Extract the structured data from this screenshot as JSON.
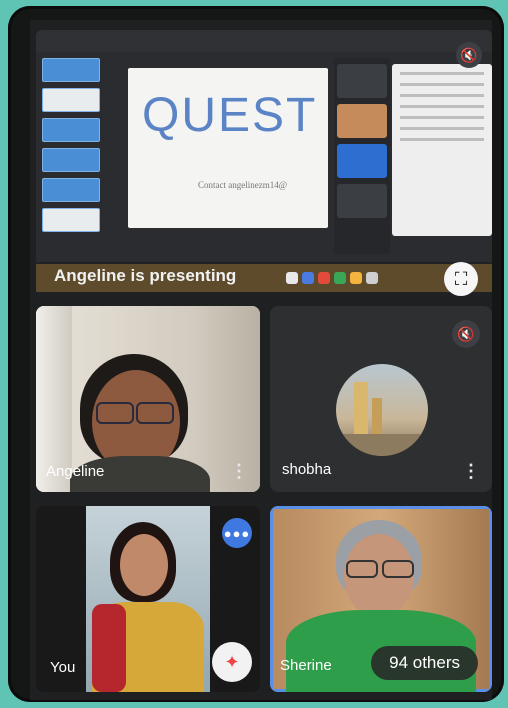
{
  "presentation": {
    "slide_title": "QUEST",
    "slide_subtitle": "Contact angelinezm14@",
    "presenting_label": "Angeline is presenting",
    "fullscreen_icon": "fullscreen-icon",
    "mute_icon": "mic-off-icon"
  },
  "participants": [
    {
      "name": "Angeline"
    },
    {
      "name": "shobha",
      "mic": "mic-off-icon"
    },
    {
      "name": "You",
      "speaking_icon": "audio-wave-icon",
      "effects_icon": "sparkle-icon"
    },
    {
      "name": "Sherine",
      "others": "94 others"
    }
  ],
  "colors": {
    "speaking_indicator": "#3f78e0",
    "active_speaker_border": "#5a8fe6"
  }
}
